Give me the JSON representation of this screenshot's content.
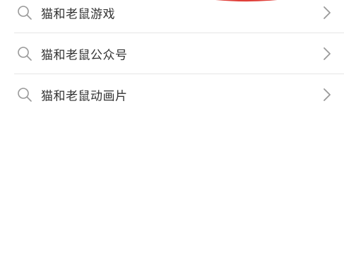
{
  "suggestions": [
    {
      "label": "猫和老鼠游戏"
    },
    {
      "label": "猫和老鼠公众号"
    },
    {
      "label": "猫和老鼠动画片"
    }
  ],
  "icons": {
    "search": "search-icon",
    "chevron": "chevron-right-icon"
  },
  "colors": {
    "accent_red": "#e0403a",
    "text": "#333333",
    "icon_gray": "#999999",
    "divider": "#e6e6e6"
  }
}
